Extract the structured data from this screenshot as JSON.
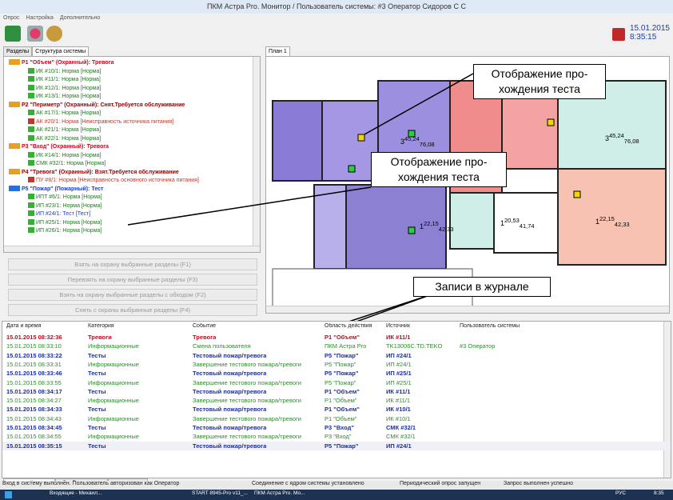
{
  "window": {
    "title": "ПКМ Астра Pro. Монитор / Пользователь системы: #3 Оператор Сидоров С С"
  },
  "menu": [
    "Опрос",
    "Настройка",
    "Дополнительно"
  ],
  "datetime": {
    "date": "15.01.2015",
    "time": "8:35:15"
  },
  "left_tabs": [
    "Разделы",
    "Структура системы"
  ],
  "tree": [
    {
      "text": "P1 \"Объем\" (Охранный): Тревога",
      "color": "#d0021b",
      "bold": true,
      "indent": 0,
      "icon": "partition-icon"
    },
    {
      "text": "ИК #10/1: Норма [Норма]",
      "color": "#1f7a1f",
      "bold": false,
      "indent": 1,
      "icon": "sensor-icon"
    },
    {
      "text": "ИК #11/1: Норма [Норма]",
      "color": "#1f7a1f",
      "bold": false,
      "indent": 1,
      "icon": "sensor-icon"
    },
    {
      "text": "ИК #12/1: Норма [Норма]",
      "color": "#1f7a1f",
      "bold": false,
      "indent": 1,
      "icon": "sensor-icon"
    },
    {
      "text": "ИК #13/1: Норма [Норма]",
      "color": "#1f7a1f",
      "bold": false,
      "indent": 1,
      "icon": "sensor-icon"
    },
    {
      "text": "P2 \"Периметр\" (Охранный): Снят.Требуется обслуживание",
      "color": "#8b0000",
      "bold": true,
      "indent": 0,
      "icon": "partition-icon"
    },
    {
      "text": "АК #17/1: Норма [Норма]",
      "color": "#1f7a1f",
      "bold": false,
      "indent": 1,
      "icon": "sensor-icon"
    },
    {
      "text": "АК #20/1: Норма [Неисправность источника питания]",
      "color": "#c0392b",
      "bold": false,
      "indent": 1,
      "icon": "sensor-icon"
    },
    {
      "text": "АК #21/1: Норма [Норма]",
      "color": "#1f7a1f",
      "bold": false,
      "indent": 1,
      "icon": "sensor-icon"
    },
    {
      "text": "АК #22/1: Норма [Норма]",
      "color": "#1f7a1f",
      "bold": false,
      "indent": 1,
      "icon": "sensor-icon"
    },
    {
      "text": "P3 \"Вход\" (Охранный): Тревога",
      "color": "#d0021b",
      "bold": true,
      "indent": 0,
      "icon": "partition-icon"
    },
    {
      "text": "ИК #14/1: Норма [Норма]",
      "color": "#1f7a1f",
      "bold": false,
      "indent": 1,
      "icon": "sensor-icon"
    },
    {
      "text": "СМК #32/1: Норма [Норма]",
      "color": "#1f7a1f",
      "bold": false,
      "indent": 1,
      "icon": "sensor-icon"
    },
    {
      "text": "P4 \"Тревога\" (Охранный): Взят.Требуется обслуживание",
      "color": "#8b0000",
      "bold": true,
      "indent": 0,
      "icon": "partition-icon"
    },
    {
      "text": "ПУ #8/1: Норма [Неисправность основного источника питания]",
      "color": "#c0392b",
      "bold": false,
      "indent": 1,
      "icon": "panic-icon"
    },
    {
      "text": "P5 \"Пожар\" (Пожарный): Тест",
      "color": "#1a3fc4",
      "bold": true,
      "indent": 0,
      "icon": "fire-partition-icon"
    },
    {
      "text": "ИПТ #6/1: Норма [Норма]",
      "color": "#1f7a1f",
      "bold": false,
      "indent": 1,
      "icon": "sensor-icon"
    },
    {
      "text": "ИП #23/1: Норма [Норма]",
      "color": "#1f7a1f",
      "bold": false,
      "indent": 1,
      "icon": "sensor-icon"
    },
    {
      "text": "ИП #24/1: Тест [Тест]",
      "color": "#1a3fc4",
      "bold": false,
      "indent": 1,
      "icon": "sensor-icon"
    },
    {
      "text": "ИП #25/1: Норма [Норма]",
      "color": "#1f7a1f",
      "bold": false,
      "indent": 1,
      "icon": "sensor-icon"
    },
    {
      "text": "ИП #26/1: Норма [Норма]",
      "color": "#1f7a1f",
      "bold": false,
      "indent": 1,
      "icon": "sensor-icon"
    }
  ],
  "buttons": [
    "Взять на охрану выбранные разделы (F1)",
    "Перевзять на охрану выбранные разделы (F3)",
    "Взять на охрану выбранные разделы с обходом (F2)",
    "Снять с охраны выбранные разделы (F4)"
  ],
  "plan_tab": "План 1",
  "rooms": [
    {
      "label_top": "45,24",
      "label_bot": "76,08",
      "prefix": "3"
    },
    {
      "label_top": "45,24",
      "label_bot": "76,08",
      "prefix": "3"
    },
    {
      "label_top": "22,15",
      "label_bot": "42,33",
      "prefix": "1"
    },
    {
      "label_top": "20,53",
      "label_bot": "41,74",
      "prefix": "1"
    },
    {
      "label_top": "22,15",
      "label_bot": "42,33",
      "prefix": "1"
    }
  ],
  "callouts": [
    "Отображение про-\nхождения теста",
    "Отображение про-\nхождения теста",
    "Записи в журнале"
  ],
  "journal": {
    "headers": [
      "Дата и время",
      "Категория",
      "Событие",
      "Область действия",
      "Источник",
      "Пользователь системы"
    ],
    "rows": [
      {
        "dt": "15.01.2015 08:32:36",
        "cat": "Тревоги",
        "ev": "Тревога",
        "area": "P1 \"Объем\"",
        "src": "ИК #11/1",
        "user": "",
        "color": "#d0021b",
        "bold": true
      },
      {
        "dt": "15.01.2015 08:33:10",
        "cat": "Информационные",
        "ev": "Смена пользователя",
        "area": "ПКМ Астра Pro",
        "src": "TK13006C.TD.TEKO",
        "user": "#3 Оператор",
        "color": "#2e8b2e",
        "bold": false
      },
      {
        "dt": "15.01.2015 08:33:22",
        "cat": "Тесты",
        "ev": "Тестовый пожар/тревога",
        "area": "P5 \"Пожар\"",
        "src": "ИП #24/1",
        "user": "",
        "color": "#1a2fa8",
        "bold": true
      },
      {
        "dt": "15.01.2015 08:33:31",
        "cat": "Информационные",
        "ev": "Завершение тестового пожара/тревоги",
        "area": "P5 \"Пожар\"",
        "src": "ИП #24/1",
        "user": "",
        "color": "#2e8b2e",
        "bold": false
      },
      {
        "dt": "15.01.2015 08:33:46",
        "cat": "Тесты",
        "ev": "Тестовый пожар/тревога",
        "area": "P5 \"Пожар\"",
        "src": "ИП #25/1",
        "user": "",
        "color": "#1a2fa8",
        "bold": true
      },
      {
        "dt": "15.01.2015 08:33:55",
        "cat": "Информационные",
        "ev": "Завершение тестового пожара/тревоги",
        "area": "P5 \"Пожар\"",
        "src": "ИП #25/1",
        "user": "",
        "color": "#2e8b2e",
        "bold": false
      },
      {
        "dt": "15.01.2015 08:34:17",
        "cat": "Тесты",
        "ev": "Тестовый пожар/тревога",
        "area": "P1 \"Объем\"",
        "src": "ИК #11/1",
        "user": "",
        "color": "#1a2fa8",
        "bold": true
      },
      {
        "dt": "15.01.2015 08:34:27",
        "cat": "Информационные",
        "ev": "Завершение тестового пожара/тревоги",
        "area": "P1 \"Объем\"",
        "src": "ИК #11/1",
        "user": "",
        "color": "#2e8b2e",
        "bold": false
      },
      {
        "dt": "15.01.2015 08:34:33",
        "cat": "Тесты",
        "ev": "Тестовый пожар/тревога",
        "area": "P1 \"Объем\"",
        "src": "ИК #10/1",
        "user": "",
        "color": "#1a2fa8",
        "bold": true
      },
      {
        "dt": "15.01.2015 08:34:43",
        "cat": "Информационные",
        "ev": "Завершение тестового пожара/тревоги",
        "area": "P1 \"Объем\"",
        "src": "ИК #10/1",
        "user": "",
        "color": "#2e8b2e",
        "bold": false
      },
      {
        "dt": "15.01.2015 08:34:45",
        "cat": "Тесты",
        "ev": "Тестовый пожар/тревога",
        "area": "P3 \"Вход\"",
        "src": "СМК #32/1",
        "user": "",
        "color": "#1a2fa8",
        "bold": true
      },
      {
        "dt": "15.01.2015 08:34:55",
        "cat": "Информационные",
        "ev": "Завершение тестового пожара/тревоги",
        "area": "P3 \"Вход\"",
        "src": "СМК #32/1",
        "user": "",
        "color": "#2e8b2e",
        "bold": false
      },
      {
        "dt": "15.01.2015 08:35:15",
        "cat": "Тесты",
        "ev": "Тестовый пожар/тревога",
        "area": "P5 \"Пожар\"",
        "src": "ИП #24/1",
        "user": "",
        "color": "#1a2fa8",
        "bold": true
      }
    ]
  },
  "bottom_tabs": [
    "Дежурный режим",
    "Обработка тревог",
    "Архив тревог"
  ],
  "status": {
    "s1": "Вход в систему выполнен. Пользователь авторизован как Оператор",
    "s2": "Соединение с ядром системы установлено",
    "s3": "Периодический опрос запущен",
    "s4": "Запрос выполнен успешно"
  },
  "taskbar": {
    "items": [
      "Входящие - Михаил...",
      "START 8945-Pro v11_...",
      "ПКМ Астра Pro. Мо..."
    ],
    "lang": "РУС",
    "clock": "8:35"
  }
}
